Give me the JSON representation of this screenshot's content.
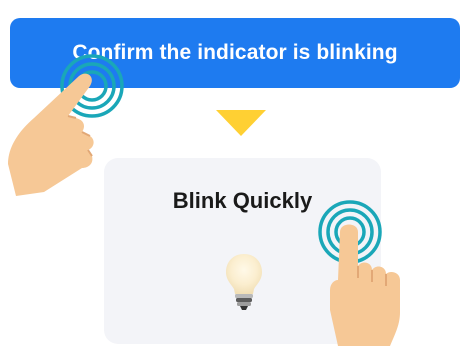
{
  "banner": {
    "instruction": "Confirm the indicator is blinking"
  },
  "card": {
    "title": "Blink Quickly"
  },
  "icons": {
    "arrow": "arrow-down-icon",
    "bulb": "light-bulb-icon",
    "tap_hand": "tap-hand-icon"
  },
  "colors": {
    "banner": "#1e7bf0",
    "arrow": "#ffd033",
    "card": "#f3f4f8",
    "tap_ring": "#1aa7b8",
    "skin": "#f6c896"
  }
}
